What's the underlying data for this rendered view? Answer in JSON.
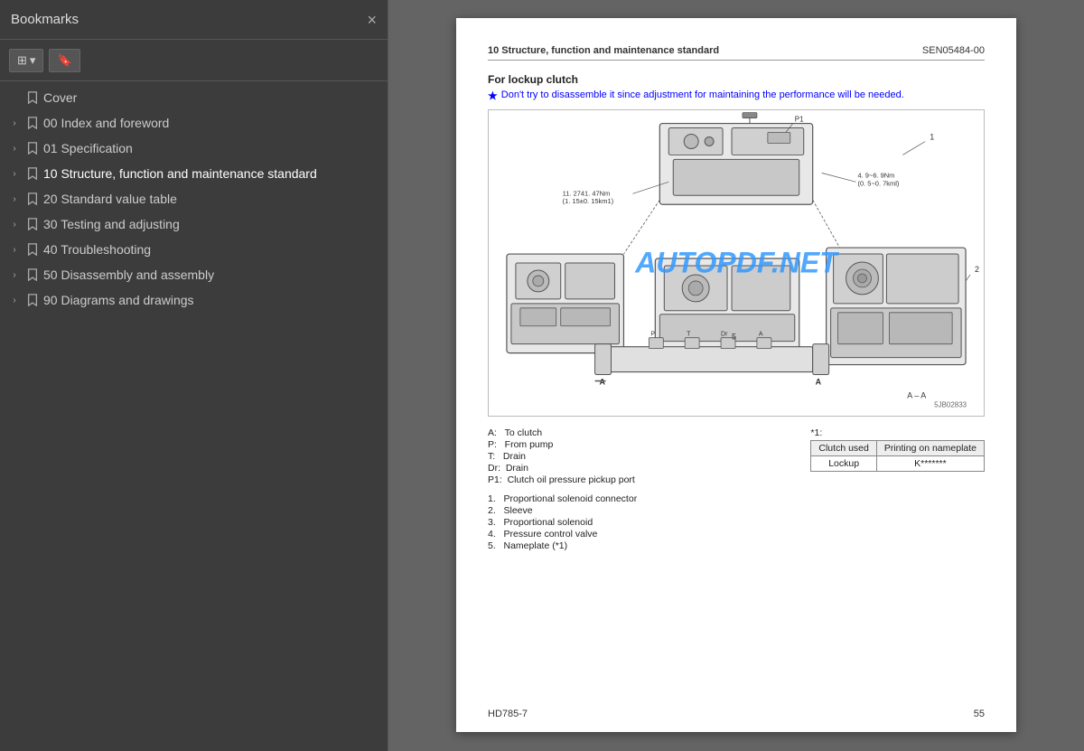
{
  "sidebar": {
    "title": "Bookmarks",
    "close_label": "×",
    "toolbar": {
      "view_btn": "≡ ▾",
      "bookmark_btn": "🔖"
    },
    "items": [
      {
        "id": "cover",
        "label": "Cover",
        "expandable": false,
        "indent": 0
      },
      {
        "id": "00",
        "label": "00 Index and foreword",
        "expandable": true,
        "indent": 0
      },
      {
        "id": "01",
        "label": "01 Specification",
        "expandable": true,
        "indent": 0
      },
      {
        "id": "10",
        "label": "10 Structure, function and maintenance standard",
        "expandable": true,
        "indent": 0,
        "active": true
      },
      {
        "id": "20",
        "label": "20 Standard value table",
        "expandable": true,
        "indent": 0
      },
      {
        "id": "30",
        "label": "30 Testing and adjusting",
        "expandable": true,
        "indent": 0
      },
      {
        "id": "40",
        "label": "40 Troubleshooting",
        "expandable": true,
        "indent": 0
      },
      {
        "id": "50",
        "label": "50 Disassembly and assembly",
        "expandable": true,
        "indent": 0
      },
      {
        "id": "90",
        "label": "90 Diagrams and drawings",
        "expandable": true,
        "indent": 0
      }
    ]
  },
  "page": {
    "header": {
      "left": "10 Structure, function and maintenance standard",
      "right": "SEN05484-00"
    },
    "section": "For lockup clutch",
    "warning": "Don't try to disassemble it since adjustment for maintaining the performance will be needed.",
    "diagram_ref": "5JB02833",
    "legend": {
      "left": [
        "A:   To clutch",
        "P:   From pump",
        "T:   Drain",
        "Dr:  Drain",
        "P1:  Clutch oil pressure pickup port"
      ],
      "right_star": "*1:",
      "table_headers": [
        "Clutch used",
        "Printing on nameplate"
      ],
      "table_rows": [
        [
          "Lockup",
          "K*******"
        ]
      ]
    },
    "numbered_items": [
      "1.   Proportional solenoid connector",
      "2.   Sleeve",
      "3.   Proportional solenoid",
      "4.   Pressure control valve",
      "5.   Nameplate (*1)"
    ],
    "torque_notes": [
      "11. 2741. 47Nm",
      "(1. 15±0. 15km1)",
      "4. 9~6. 9Nm",
      "(0. 5~0. 7kml)"
    ],
    "diagram_label_aa": "A – A",
    "footer": {
      "left": "HD785-7",
      "right": "55"
    }
  },
  "watermark": {
    "text": "AUTOPDF.NET"
  },
  "icons": {
    "bookmark": "bookmark",
    "chevron_right": "›",
    "view": "view-options-icon",
    "bookmark_toolbar": "bookmark-toolbar-icon"
  }
}
